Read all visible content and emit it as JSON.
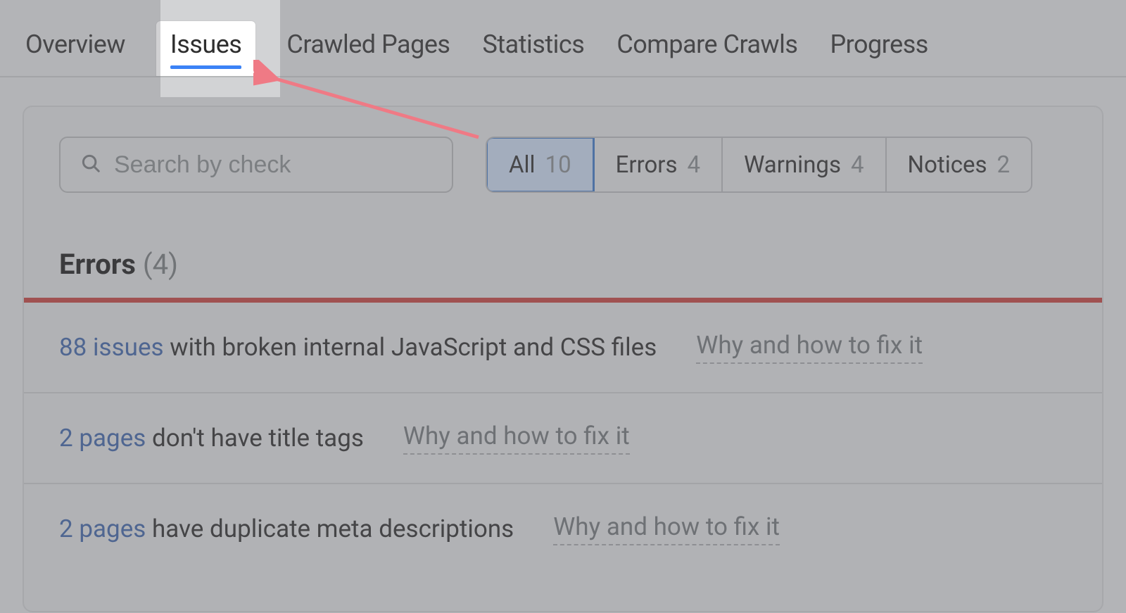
{
  "tabs": [
    {
      "label": "Overview"
    },
    {
      "label": "Issues"
    },
    {
      "label": "Crawled Pages"
    },
    {
      "label": "Statistics"
    },
    {
      "label": "Compare Crawls"
    },
    {
      "label": "Progress"
    }
  ],
  "active_tab_index": 1,
  "search": {
    "placeholder": "Search by check"
  },
  "filters": {
    "all": {
      "label": "All",
      "count": "10"
    },
    "errors": {
      "label": "Errors",
      "count": "4"
    },
    "warnings": {
      "label": "Warnings",
      "count": "4"
    },
    "notices": {
      "label": "Notices",
      "count": "2"
    },
    "selected": "all"
  },
  "section": {
    "label": "Errors",
    "count_text": "(4)"
  },
  "fix_link_label": "Why and how to fix it",
  "issues": [
    {
      "link_text": "88 issues",
      "rest": " with broken internal JavaScript and CSS files"
    },
    {
      "link_text": "2 pages",
      "rest": " don't have title tags"
    },
    {
      "link_text": "2 pages",
      "rest": " have duplicate meta descriptions"
    }
  ],
  "colors": {
    "accent_blue": "#3b82f6",
    "error_red": "#b53d3a",
    "link_blue": "#3a5d9b"
  }
}
